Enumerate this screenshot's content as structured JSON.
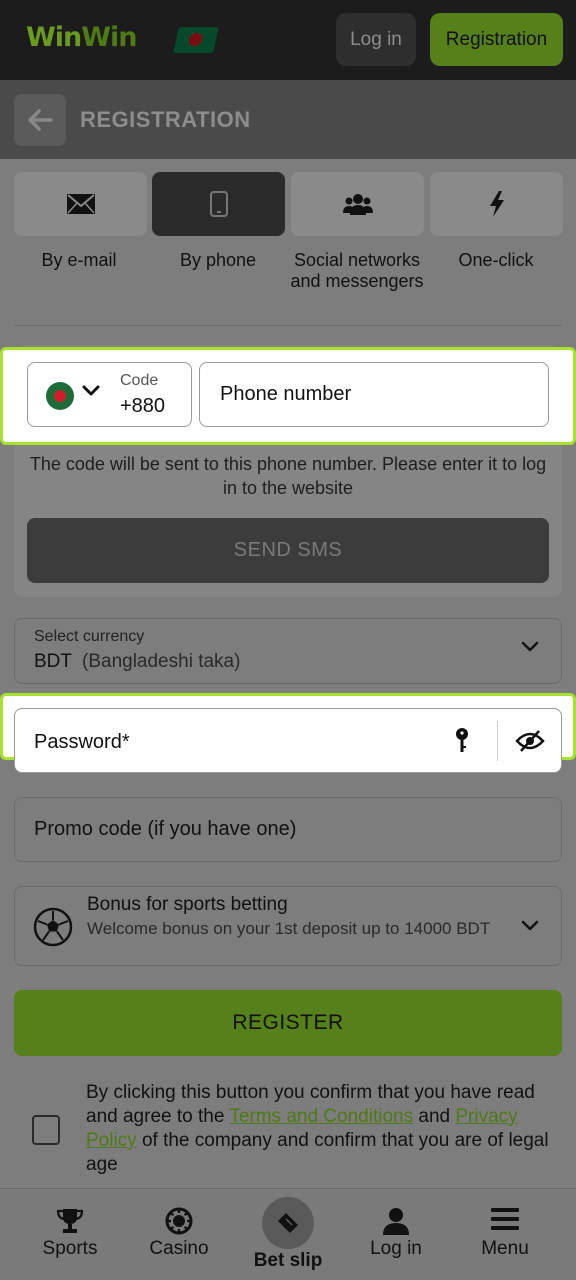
{
  "header": {
    "logo_a": "Win",
    "logo_b": "Win",
    "login_label": "Log in",
    "registration_label": "Registration"
  },
  "page": {
    "title": "REGISTRATION"
  },
  "tabs": [
    {
      "label": "By e-mail",
      "icon": "envelope-icon",
      "active": false
    },
    {
      "label": "By phone",
      "icon": "smartphone-icon",
      "active": true
    },
    {
      "label": "Social networks and messengers",
      "icon": "users-icon",
      "active": false
    },
    {
      "label": "One-click",
      "icon": "lightning-icon",
      "active": false
    }
  ],
  "phone": {
    "code_label": "Code",
    "code_value": "+880",
    "placeholder": "Phone number",
    "hint": "The code will be sent to this phone number. Please enter it to log in to the website",
    "send_sms_label": "SEND SMS"
  },
  "currency": {
    "label": "Select currency",
    "code": "BDT",
    "name": "(Bangladeshi taka)"
  },
  "password": {
    "placeholder": "Password*"
  },
  "promo": {
    "placeholder": "Promo code (if you have one)"
  },
  "bonus": {
    "title": "Bonus for sports betting",
    "description": "Welcome bonus on your 1st deposit up to 14000 BDT"
  },
  "register_label": "REGISTER",
  "terms": {
    "text_1": "By clicking this button you confirm that you have read and agree to the ",
    "terms_link": "Terms and Conditions",
    "text_2": " and ",
    "privacy_link": "Privacy Policy",
    "text_3": " of the company and confirm that you are of legal age",
    "checked": false
  },
  "bottom_nav": [
    {
      "label": "Sports",
      "icon": "trophy-icon"
    },
    {
      "label": "Casino",
      "icon": "casino-chip-icon"
    },
    {
      "label": "Bet slip",
      "icon": "ticket-icon"
    },
    {
      "label": "Log in",
      "icon": "user-icon"
    },
    {
      "label": "Menu",
      "icon": "hamburger-icon"
    }
  ],
  "colors": {
    "accent_green": "#55801a",
    "highlight_outline": "#a6e22e",
    "link_green": "#4f7a14"
  }
}
